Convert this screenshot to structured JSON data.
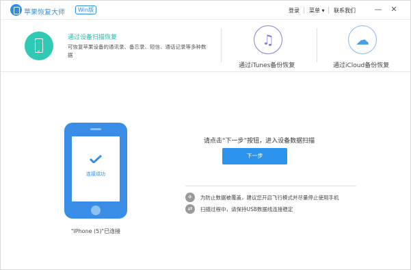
{
  "titlebar": {
    "app_name": "苹果恢复大师",
    "badge": "Win版",
    "login": "登录",
    "menu": "菜单 ▾",
    "contact": "联系我们",
    "min_glyph": "—",
    "close_glyph": "✕"
  },
  "tabs": {
    "active": {
      "title": "通过设备扫描恢复",
      "description": "可恢复苹果设备的通讯录、备忘录、短信、通话记录等多种数据"
    },
    "itunes": {
      "label": "通过iTunes备份恢复",
      "glyph": "♫"
    },
    "icloud": {
      "label": "通过iCloud备份恢复",
      "glyph": "☁"
    }
  },
  "device": {
    "status": "连接成功",
    "name": "\"iPhone (5)\"已连接"
  },
  "main": {
    "instruction": "请点击“下一步”按钮，进入设备数据扫描",
    "next_button": "下一步",
    "tips": [
      {
        "icon": "airplane-icon",
        "glyph": "✈",
        "text": "为防止数据被覆盖，建议您开启飞行模式并尽量停止使用手机"
      },
      {
        "icon": "usb-icon",
        "glyph": "⇄",
        "text": "扫描过程中，请保持USB数据线连接稳定"
      }
    ]
  },
  "colors": {
    "accent_blue": "#2c93ec",
    "accent_teal": "#2fc9b4",
    "itunes_purple": "#8e7ad6"
  }
}
